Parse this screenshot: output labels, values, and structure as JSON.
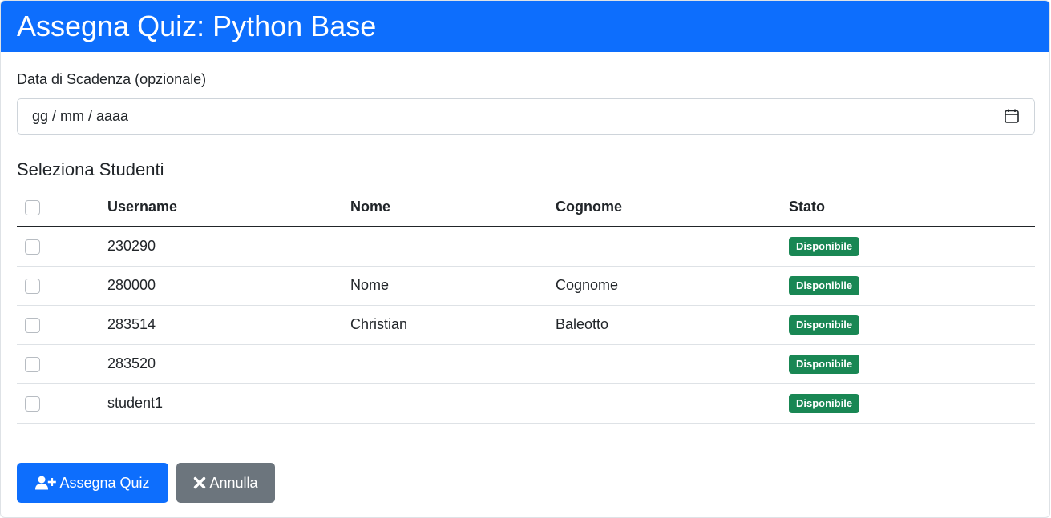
{
  "header": {
    "title": "Assegna Quiz: Python Base"
  },
  "due_date": {
    "label": "Data di Scadenza (opzionale)",
    "placeholder": "gg / mm / aaaa",
    "icon": "calendar-icon"
  },
  "students": {
    "title": "Seleziona Studenti",
    "columns": [
      "Username",
      "Nome",
      "Cognome",
      "Stato"
    ],
    "rows": [
      {
        "username": "230290",
        "nome": "",
        "cognome": "",
        "stato": "Disponibile"
      },
      {
        "username": "280000",
        "nome": "Nome",
        "cognome": "Cognome",
        "stato": "Disponibile"
      },
      {
        "username": "283514",
        "nome": "Christian",
        "cognome": "Baleotto",
        "stato": "Disponibile"
      },
      {
        "username": "283520",
        "nome": "",
        "cognome": "",
        "stato": "Disponibile"
      },
      {
        "username": "student1",
        "nome": "",
        "cognome": "",
        "stato": "Disponibile"
      }
    ]
  },
  "actions": {
    "assign_label": "Assegna Quiz",
    "assign_icon": "user-plus-icon",
    "cancel_label": "Annulla",
    "cancel_icon": "close-icon"
  },
  "colors": {
    "primary": "#0d6efd",
    "secondary": "#6c757d",
    "success": "#198754"
  }
}
